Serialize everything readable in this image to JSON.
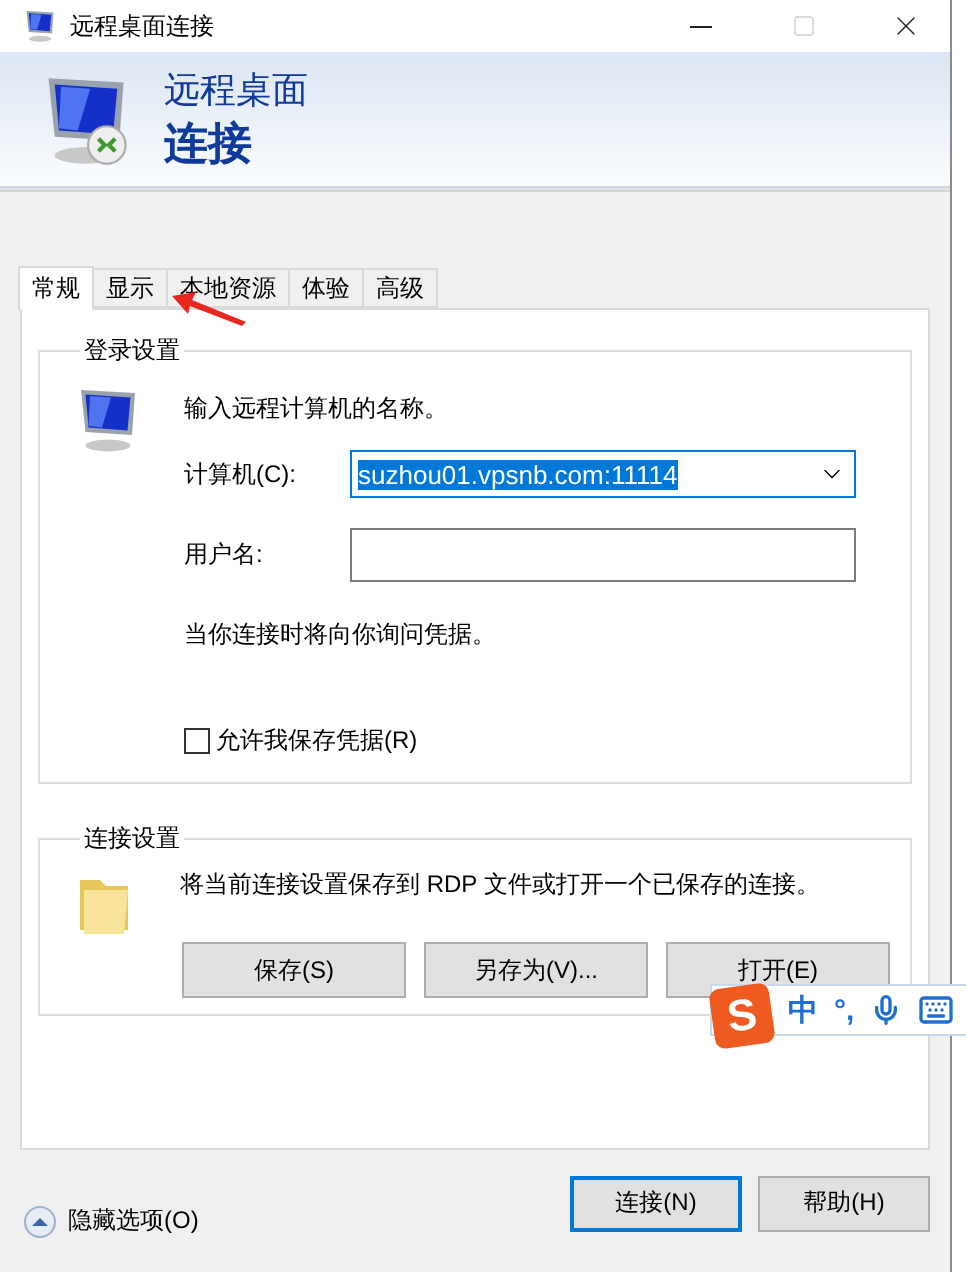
{
  "window": {
    "title": "远程桌面连接"
  },
  "banner": {
    "line1": "远程桌面",
    "line2": "连接"
  },
  "tabs": [
    {
      "label": "常规",
      "selected": true
    },
    {
      "label": "显示",
      "selected": false
    },
    {
      "label": "本地资源",
      "selected": false
    },
    {
      "label": "体验",
      "selected": false
    },
    {
      "label": "高级",
      "selected": false
    }
  ],
  "login_group": {
    "title": "登录设置",
    "prompt": "输入远程计算机的名称。",
    "computer": {
      "label": "计算机(C):",
      "value": "suzhou01.vpsnb.com:11114"
    },
    "username": {
      "label": "用户名:"
    },
    "note": "当你连接时将向你询问凭据。",
    "save_credentials": {
      "label": "允许我保存凭据(R)",
      "checked": false
    }
  },
  "connection_group": {
    "title": "连接设置",
    "description": "将当前连接设置保存到 RDP 文件或打开一个已保存的连接。",
    "buttons": [
      "保存(S)",
      "另存为(V)...",
      "打开(E)"
    ]
  },
  "options_toggle": "隐藏选项(O)",
  "buttons": [
    {
      "label": "连接(N)",
      "default": true
    },
    {
      "label": "帮助(H)",
      "default": false
    }
  ],
  "ime_bar": {
    "logo": "S",
    "mode": "中",
    "punctuation": "°,"
  }
}
